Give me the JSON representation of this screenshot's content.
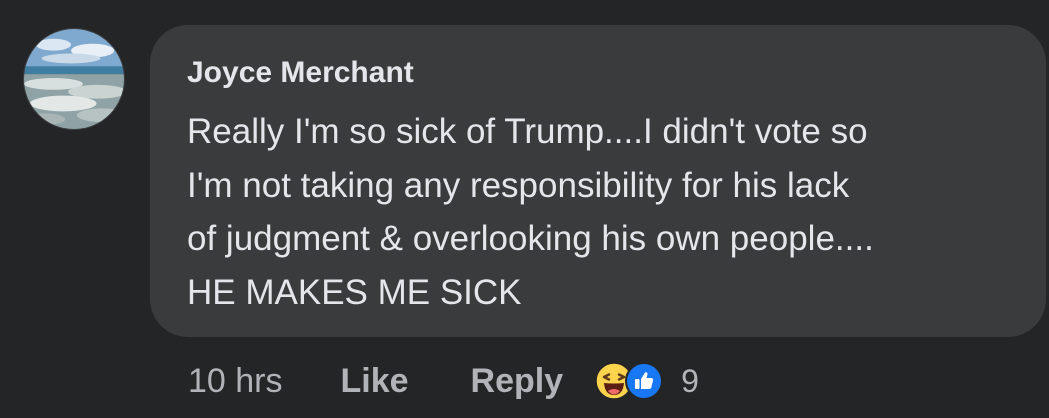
{
  "comment": {
    "author": "Joyce Merchant",
    "lines": [
      "Really I'm so sick of Trump....I didn't vote so",
      "I'm not taking any responsibility for his lack",
      "of judgment & overlooking his own people....",
      "HE MAKES ME SICK"
    ],
    "avatar_icon": "beach-photo-avatar"
  },
  "actions": {
    "timestamp": "10 hrs",
    "like_label": "Like",
    "reply_label": "Reply"
  },
  "reactions": {
    "icons": [
      "haha-emoji-icon",
      "like-thumb-icon"
    ],
    "count": "9"
  },
  "colors": {
    "background": "#242526",
    "bubble": "#3a3b3c",
    "text_primary": "#e4e6eb",
    "text_secondary": "#b0b3b8",
    "like_blue": "#1877f2",
    "haha_yellow": "#fcd34d"
  }
}
